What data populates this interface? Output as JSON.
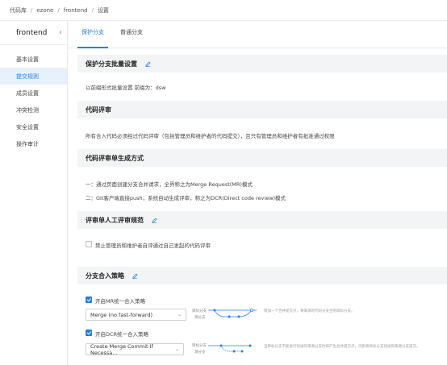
{
  "breadcrumb": [
    "代码库",
    "ezone",
    "frontend",
    "设置"
  ],
  "sidebar": {
    "title": "frontend",
    "items": [
      {
        "label": "基本设置",
        "active": false
      },
      {
        "label": "提交规则",
        "active": true
      },
      {
        "label": "成员设置",
        "active": false
      },
      {
        "label": "冲突检测",
        "active": false
      },
      {
        "label": "安全设置",
        "active": false
      },
      {
        "label": "操作审计",
        "active": false
      }
    ]
  },
  "tabs": [
    {
      "label": "保护分支",
      "active": true
    },
    {
      "label": "普通分支",
      "active": false
    }
  ],
  "sections": {
    "batch": {
      "title": "保护分支批量设置",
      "text": "以前缀形式批量设置    前缀为：dsw"
    },
    "review": {
      "title": "代码评审",
      "text": "所有合入代码必须经过代码评审（包括管理员和维护者的代码提交），且只有管理员和维护者有批准通过权限"
    },
    "generate": {
      "title": "代码评审单生成方式",
      "line1": "一：通过页面创建分支合并请求，全界称之为Merge Request(MR)模式",
      "line2": "二：Git客户端直接push，系统自动生成评审，称之为DCR(Direct code review)模式"
    },
    "manual": {
      "title": "评审单人工评审规范",
      "checkbox_label": "禁止管理员和维护者自评通过自己发起的代码评审"
    },
    "merge": {
      "title": "分支合入策略",
      "mr_label": "开启MR统一合入策略",
      "mr_select": "Merge (no fast-forward)",
      "mr_target": "目标分支",
      "mr_source": "源分支",
      "mr_desc": "增加一个合并提交点，将来源的代码分支合到目标分支。",
      "dcr_label": "开启DCR统一合入策略",
      "dcr_select": "Create Merge Commit If Necessa...",
      "dcr_target": "目标分支",
      "dcr_source": "源分支",
      "dcr_desc": "当目标分支不能进行快进的来源分支时将产生合并提交点，否则将目标分支快进到来源分支提交。"
    }
  },
  "colors": {
    "accent": "#1e80e3",
    "section_bg": "#f3f4f6",
    "active_bg": "#e6f1fc"
  }
}
